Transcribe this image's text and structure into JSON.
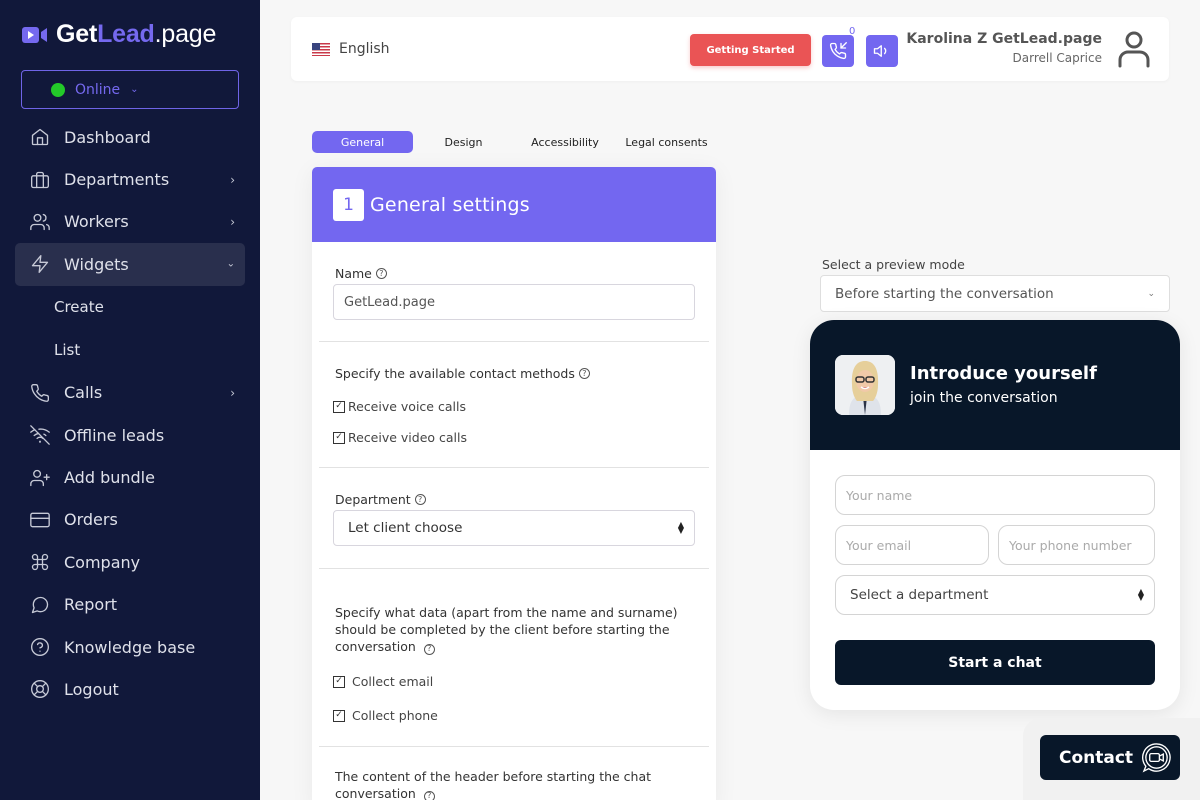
{
  "brand": {
    "logo_get": "Get",
    "logo_lead": "Lead",
    "logo_page": ".page",
    "accent_color": "#7367f0"
  },
  "status": {
    "label": "Online",
    "color": "#23c929"
  },
  "sidebar": {
    "items": [
      {
        "label": "Dashboard",
        "icon": "home-icon",
        "has_chevron": false
      },
      {
        "label": "Departments",
        "icon": "briefcase-icon",
        "has_chevron": true
      },
      {
        "label": "Workers",
        "icon": "users-icon",
        "has_chevron": true
      },
      {
        "label": "Widgets",
        "icon": "zap-icon",
        "has_chevron": true,
        "expanded": true,
        "active": true
      },
      {
        "label": "Calls",
        "icon": "phone-icon",
        "has_chevron": true
      },
      {
        "label": "Offline leads",
        "icon": "wifi-off-icon",
        "has_chevron": false
      },
      {
        "label": "Add bundle",
        "icon": "user-plus-icon",
        "has_chevron": false
      },
      {
        "label": "Orders",
        "icon": "credit-card-icon",
        "has_chevron": false
      },
      {
        "label": "Company",
        "icon": "command-icon",
        "has_chevron": false
      },
      {
        "label": "Report",
        "icon": "message-circle-icon",
        "has_chevron": false
      },
      {
        "label": "Knowledge base",
        "icon": "help-circle-icon",
        "has_chevron": false
      },
      {
        "label": "Logout",
        "icon": "life-buoy-icon",
        "has_chevron": false
      }
    ],
    "widgets_sub": [
      {
        "label": "Create"
      },
      {
        "label": "List"
      }
    ]
  },
  "header": {
    "language": "English",
    "getting_started": "Getting Started",
    "call_badge": "0",
    "user_name": "Karolina Z GetLead.page",
    "user_role": "Darrell Caprice"
  },
  "tabs": [
    {
      "label": "General",
      "active": true
    },
    {
      "label": "Design",
      "active": false
    },
    {
      "label": "Accessibility",
      "active": false
    },
    {
      "label": "Legal consents",
      "active": false
    }
  ],
  "settings": {
    "step": "1",
    "title": "General settings",
    "name_label": "Name",
    "name_value": "GetLead.page",
    "contact_methods_label": "Specify the available contact methods",
    "contact_methods": [
      {
        "label": "Receive voice calls",
        "checked": true
      },
      {
        "label": "Receive video calls",
        "checked": true
      }
    ],
    "department_label": "Department",
    "department_value": "Let client choose",
    "data_label": "Specify what data (apart from the name and surname) should be completed by the client before starting the conversation",
    "data_fields": [
      {
        "label": "Collect email",
        "checked": true
      },
      {
        "label": "Collect phone",
        "checked": true
      }
    ],
    "header_content_label": "The content of the header before starting the chat conversation"
  },
  "preview": {
    "mode_label": "Select a preview mode",
    "mode_value": "Before starting the conversation",
    "widget": {
      "title": "Introduce yourself",
      "subtitle": "join the conversation",
      "name_placeholder": "Your name",
      "email_placeholder": "Your email",
      "phone_placeholder": "Your phone number",
      "department_value": "Select a department",
      "start_button": "Start a chat",
      "dark_color": "#081729"
    },
    "contact_button": "Contact"
  }
}
